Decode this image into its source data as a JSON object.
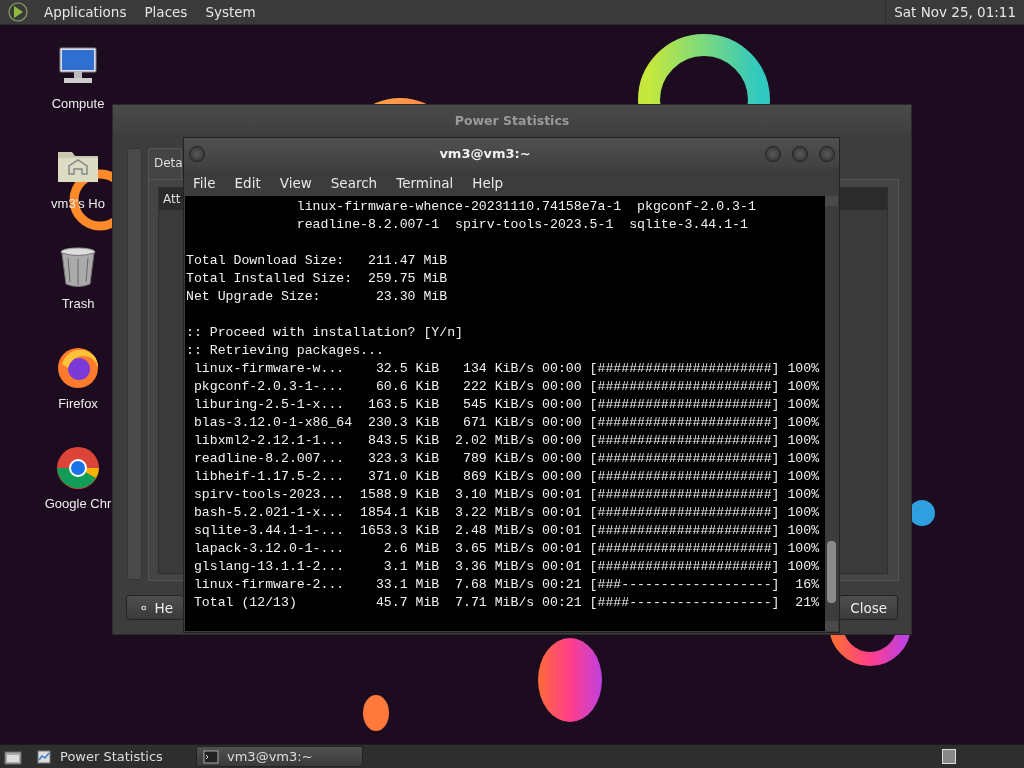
{
  "top_panel": {
    "menus": [
      {
        "label": "Applications"
      },
      {
        "label": "Places"
      },
      {
        "label": "System"
      }
    ],
    "clock": "Sat Nov 25, 01:11"
  },
  "desktop_icons": [
    {
      "kind": "computer",
      "label": "Compute"
    },
    {
      "kind": "home",
      "label": "vm3's Ho"
    },
    {
      "kind": "trash",
      "label": "Trash"
    },
    {
      "kind": "firefox",
      "label": "Firefox"
    },
    {
      "kind": "chrome",
      "label": "Google Chr"
    }
  ],
  "power_window": {
    "title": "Power Statistics",
    "tab": "Deta",
    "column_1": "Att",
    "buttons": [
      {
        "kind": "help",
        "label": "He"
      },
      {
        "kind": "close",
        "label": "Close"
      }
    ]
  },
  "terminal": {
    "title": "vm3@vm3:~",
    "menus": [
      "File",
      "Edit",
      "View",
      "Search",
      "Terminal",
      "Help"
    ],
    "output": [
      {
        "lines": [
          "              linux-firmware-whence-20231110.74158e7a-1  pkgconf-2.0.3-1",
          "              readline-8.2.007-1  spirv-tools-2023.5-1  sqlite-3.44.1-1"
        ]
      },
      {
        "lines": [
          "Total Download Size:   211.47 MiB",
          "Total Installed Size:  259.75 MiB",
          "Net Upgrade Size:       23.30 MiB"
        ]
      },
      {
        "lines": [
          ":: Proceed with installation? [Y/n]",
          ":: Retrieving packages...",
          " linux-firmware-w...    32.5 KiB   134 KiB/s 00:00 [######################] 100%",
          " pkgconf-2.0.3-1-...    60.6 KiB   222 KiB/s 00:00 [######################] 100%",
          " liburing-2.5-1-x...   163.5 KiB   545 KiB/s 00:00 [######################] 100%",
          " blas-3.12.0-1-x86_64  230.3 KiB   671 KiB/s 00:00 [######################] 100%",
          " libxml2-2.12.1-1...   843.5 KiB  2.02 MiB/s 00:00 [######################] 100%",
          " readline-8.2.007...   323.3 KiB   789 KiB/s 00:00 [######################] 100%",
          " libheif-1.17.5-2...   371.0 KiB   869 KiB/s 00:00 [######################] 100%",
          " spirv-tools-2023...  1588.9 KiB  3.10 MiB/s 00:01 [######################] 100%",
          " bash-5.2.021-1-x...  1854.1 KiB  3.22 MiB/s 00:01 [######################] 100%",
          " sqlite-3.44.1-1-...  1653.3 KiB  2.48 MiB/s 00:01 [######################] 100%",
          " lapack-3.12.0-1-...     2.6 MiB  3.65 MiB/s 00:01 [######################] 100%",
          " glslang-13.1.1-2...     3.1 MiB  3.36 MiB/s 00:01 [######################] 100%",
          " linux-firmware-2...    33.1 MiB  7.68 MiB/s 00:21 [###-------------------]  16%",
          " Total (12/13)          45.7 MiB  7.71 MiB/s 00:21 [####------------------]  21%"
        ]
      }
    ]
  },
  "taskbar": {
    "tasks": [
      {
        "kind": "power",
        "label": "Power Statistics",
        "selected": false
      },
      {
        "kind": "terminal",
        "label": "vm3@vm3:~",
        "selected": true
      }
    ]
  }
}
